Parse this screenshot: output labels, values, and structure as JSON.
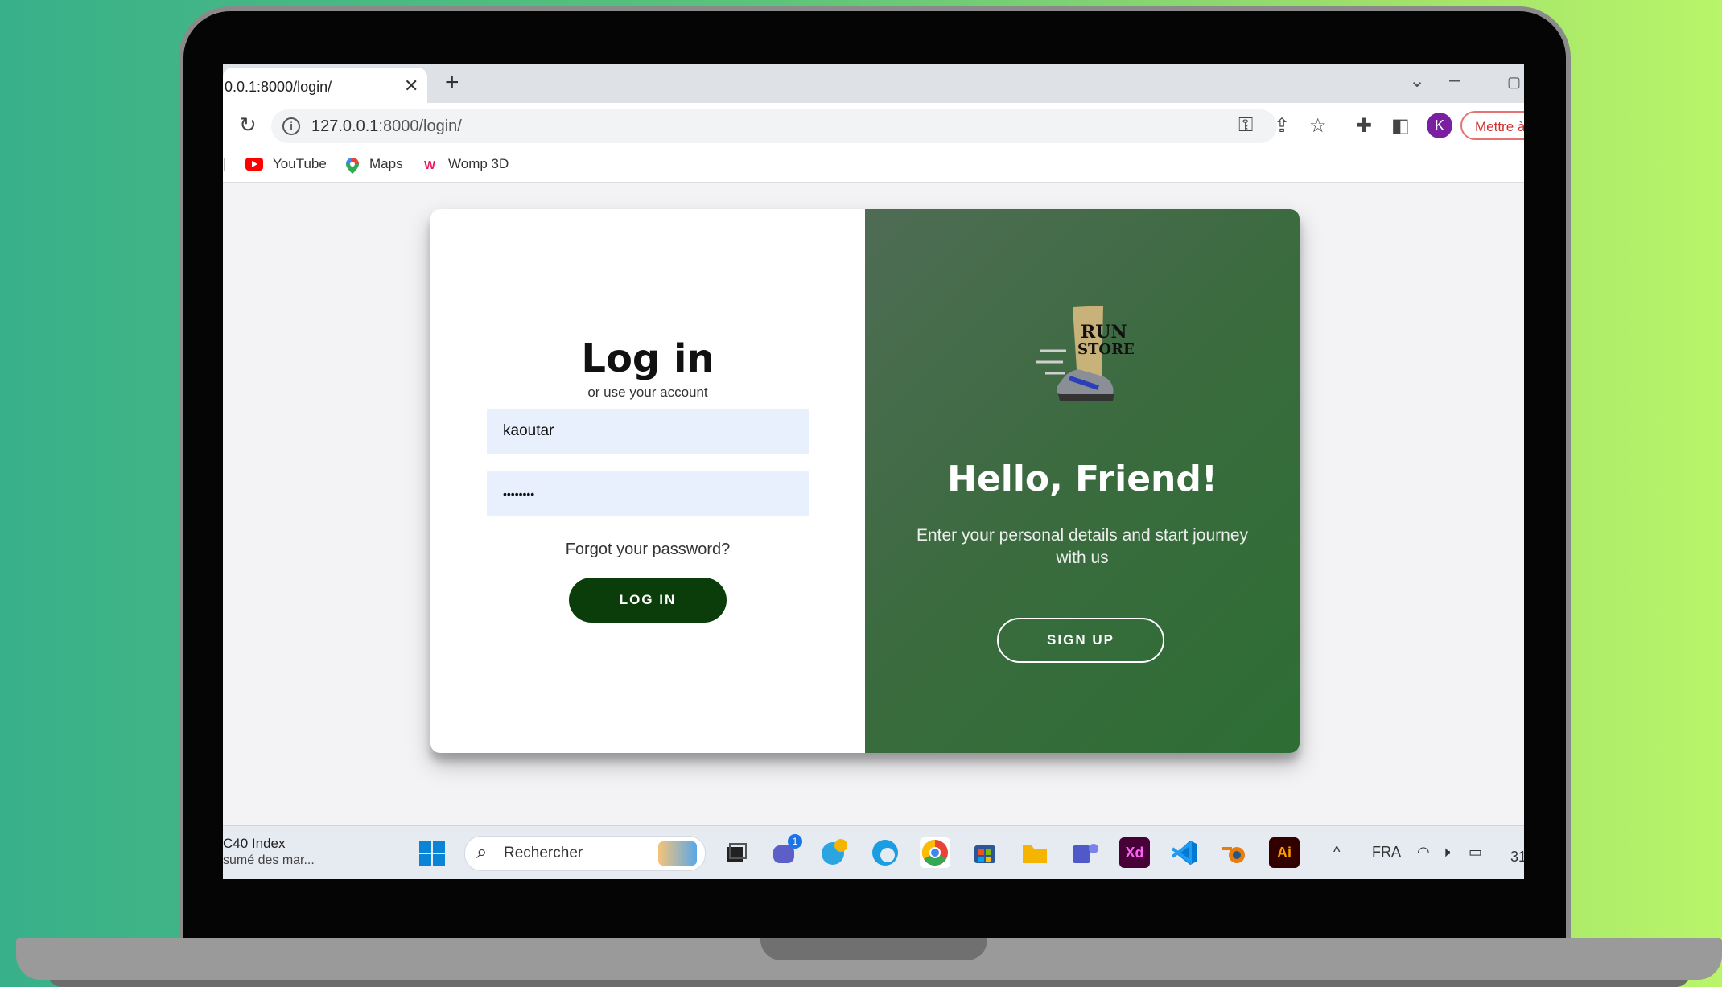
{
  "browser": {
    "tab_title": "0.0.1:8000/login/",
    "tab_close": "✕",
    "new_tab": "+",
    "url_host": "127.0.0.1",
    "url_path": ":8000/login/",
    "profile_initial": "K",
    "update_label": "Mettre à",
    "bookmarks": [
      "YouTube",
      "Maps",
      "Womp 3D"
    ]
  },
  "login": {
    "title": "Log in",
    "subtitle": "or use your account",
    "username_value": "kaoutar",
    "password_value": "••••••••",
    "forgot": "Forgot your password?",
    "button": "LOG IN"
  },
  "overlay": {
    "logo_line1": "RUN",
    "logo_line2": "STORE",
    "title": "Hello, Friend!",
    "subtitle": "Enter your personal details and start journey with us",
    "button": "SIGN UP"
  },
  "taskbar": {
    "widget_title": "C40 Index",
    "widget_subtitle": "sumé des mar...",
    "search_placeholder": "Rechercher",
    "teams_badge": "1",
    "xd_label": "Xd",
    "ai_label": "Ai",
    "language": "FRA",
    "clock_partial": "31"
  },
  "colors": {
    "overlay_green": "#2d6e34",
    "login_button": "#0b3d0b",
    "input_bg": "#e8f0fe"
  }
}
